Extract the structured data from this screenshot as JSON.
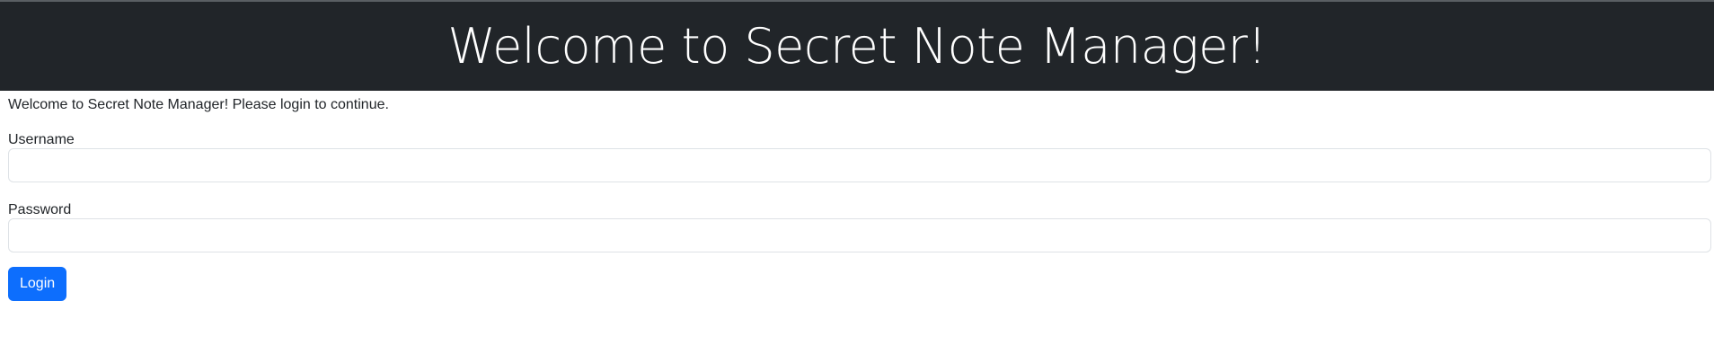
{
  "header": {
    "title": "Welcome to Secret Note Manager!"
  },
  "main": {
    "intro": "Welcome to Secret Note Manager! Please login to continue.",
    "username_label": "Username",
    "username_value": "",
    "password_label": "Password",
    "password_value": "",
    "login_label": "Login"
  },
  "colors": {
    "header_bg": "#212529",
    "primary": "#0d6efd"
  }
}
